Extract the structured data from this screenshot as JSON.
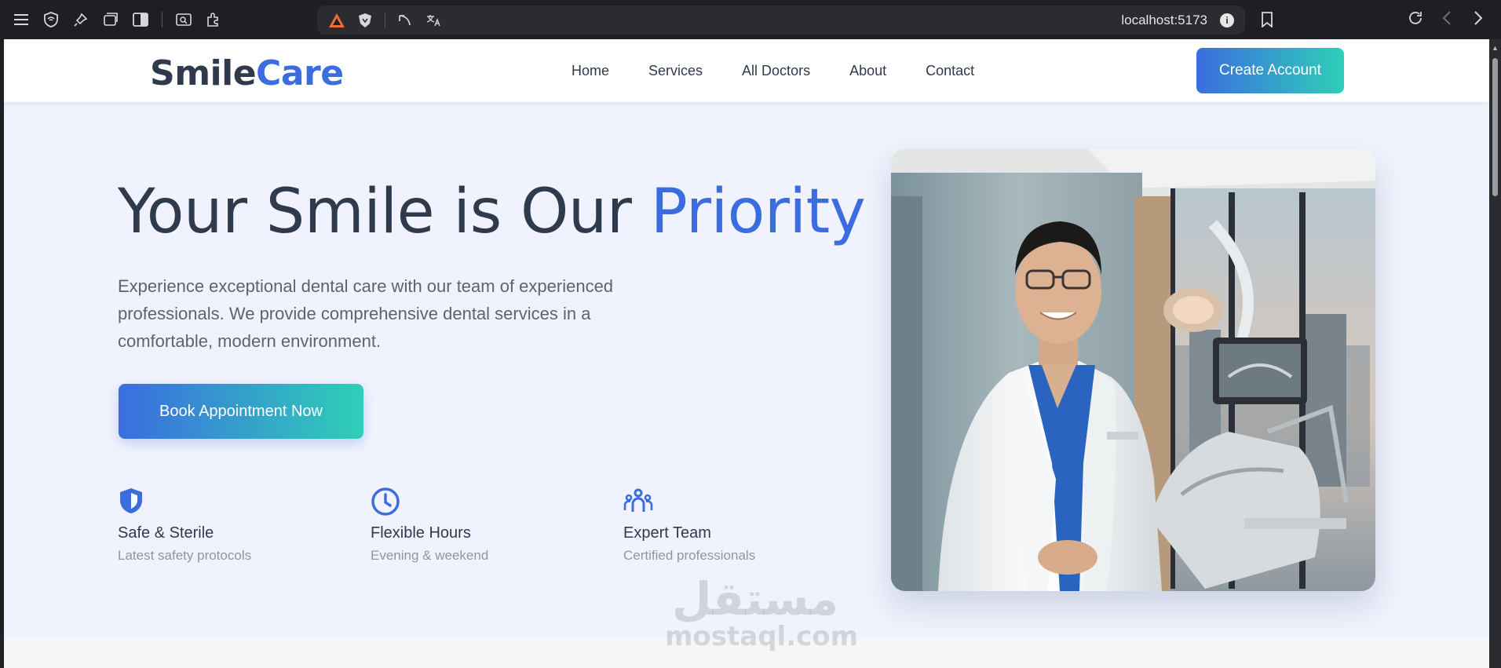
{
  "browser": {
    "url": "localhost:5173",
    "info_icon": "i"
  },
  "nav": {
    "logo_main": "Smile",
    "logo_accent": "Care",
    "links": [
      "Home",
      "Services",
      "All Doctors",
      "About",
      "Contact"
    ],
    "cta": "Create Account"
  },
  "hero": {
    "title_main": "Your Smile is Our ",
    "title_accent": "Priority",
    "subtitle": "Experience exceptional dental care with our team of experienced professionals. We provide comprehensive dental services in a comfortable, modern environment.",
    "button": "Book Appointment Now"
  },
  "features": [
    {
      "title": "Safe & Sterile",
      "desc": "Latest safety protocols",
      "icon": "shield-icon"
    },
    {
      "title": "Flexible Hours",
      "desc": "Evening & weekend",
      "icon": "clock-icon"
    },
    {
      "title": "Expert Team",
      "desc": "Certified professionals",
      "icon": "team-icon"
    }
  ],
  "watermark": {
    "arabic": "مستقل",
    "latin": "mostaql.com"
  },
  "colors": {
    "accent": "#3b6de0",
    "teal": "#2ecfb8",
    "text": "#2f3a4d",
    "hero_bg": "#f0f3fd"
  }
}
